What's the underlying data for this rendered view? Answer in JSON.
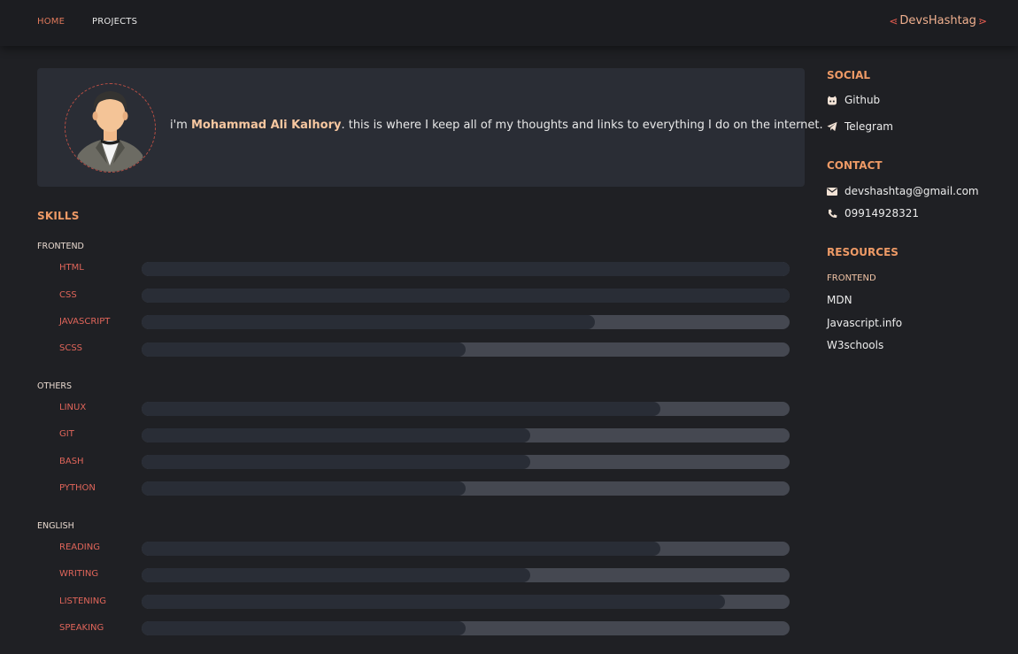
{
  "nav": {
    "home": "HOME",
    "projects": "PROJECTS",
    "brand": "DevsHashtag"
  },
  "hero": {
    "prefix": "i'm ",
    "name": "Mohammad Ali Kalhory",
    "suffix": ". this is where I keep all of my thoughts and links to everything I do on the internet."
  },
  "skills": {
    "title": "SKILLS",
    "groups": [
      {
        "label": "FRONTEND",
        "items": [
          {
            "label": "HTML",
            "level": 1.0
          },
          {
            "label": "CSS",
            "level": 1.0
          },
          {
            "label": "JAVASCRIPT",
            "level": 0.7
          },
          {
            "label": "SCSS",
            "level": 0.5
          }
        ]
      },
      {
        "label": "OTHERS",
        "items": [
          {
            "label": "LINUX",
            "level": 0.8
          },
          {
            "label": "GIT",
            "level": 0.6
          },
          {
            "label": "BASH",
            "level": 0.6
          },
          {
            "label": "PYTHON",
            "level": 0.5
          }
        ]
      },
      {
        "label": "ENGLISH",
        "items": [
          {
            "label": "READING",
            "level": 0.8
          },
          {
            "label": "WRITING",
            "level": 0.6
          },
          {
            "label": "LISTENING",
            "level": 0.9
          },
          {
            "label": "SPEAKING",
            "level": 0.5
          }
        ]
      }
    ]
  },
  "social": {
    "title": "SOCIAL",
    "items": [
      {
        "label": "Github",
        "icon": "github-icon"
      },
      {
        "label": "Telegram",
        "icon": "telegram-icon"
      }
    ]
  },
  "contact": {
    "title": "CONTACT",
    "email": "devshashtag@gmail.com",
    "phone": "09914928321"
  },
  "resources": {
    "title": "RESOURCES",
    "group": "FRONTEND",
    "links": [
      "MDN",
      "Javascript.info",
      "W3schools"
    ]
  },
  "colors": {
    "accent": "#ee9a66",
    "skill_label": "#e0655a",
    "bar_track": "#454851",
    "bar_fill": "#292d36"
  }
}
